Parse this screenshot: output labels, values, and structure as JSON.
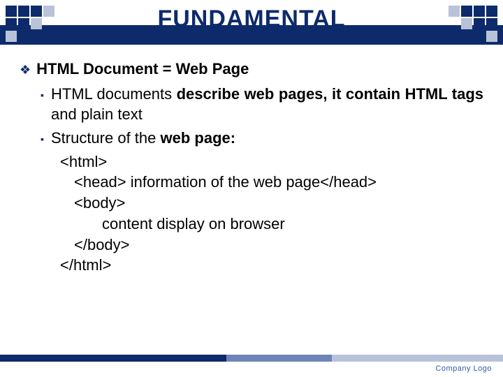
{
  "title": "FUNDAMENTAL",
  "main_bullet": "HTML Document = Web Page",
  "sub_bullets": [
    {
      "pre": "HTML documents ",
      "bold1": "describe web pages, it contain HTML tags",
      "post": " and plain text"
    },
    {
      "pre": "Structure of the ",
      "bold1": "web page:",
      "post": ""
    }
  ],
  "code": {
    "l1": "<html>",
    "l2": "<head> information of the web page</head>",
    "l3": "<body>",
    "l4": "content display on browser",
    "l5": "</body>",
    "l6": "</html>"
  },
  "footer": "Company Logo"
}
